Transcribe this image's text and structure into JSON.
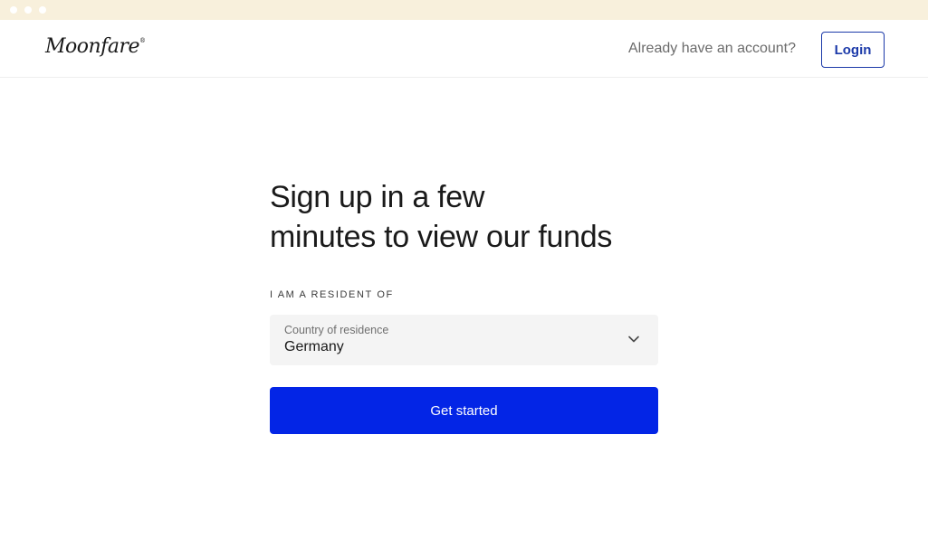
{
  "brand": {
    "name": "Moonfare",
    "registered_mark": "®"
  },
  "header": {
    "account_prompt": "Already have an account?",
    "login_label": "Login"
  },
  "main": {
    "heading_line1": "Sign up in a few",
    "heading_line2": "minutes to view our funds",
    "resident_label": "I AM A RESIDENT OF",
    "country_select": {
      "placeholder": "Country of residence",
      "value": "Germany"
    },
    "cta_label": "Get started"
  },
  "colors": {
    "primary": "#0325e6",
    "login_border": "#1c3aa9",
    "chrome_bar": "#f8f0dc",
    "select_bg": "#f4f4f4"
  },
  "icons": {
    "select_indicator": "chevron-down-icon"
  }
}
